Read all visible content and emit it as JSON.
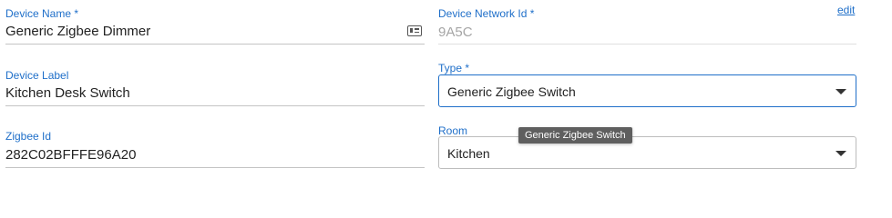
{
  "left": {
    "device_name": {
      "label": "Device Name *",
      "value": "Generic Zigbee Dimmer",
      "icon": "id-card-icon"
    },
    "device_label": {
      "label": "Device Label",
      "value": "Kitchen Desk Switch"
    },
    "zigbee_id": {
      "label": "Zigbee Id",
      "value": "282C02BFFFE96A20"
    }
  },
  "right": {
    "network_id": {
      "label": "Device Network Id *",
      "value": "9A5C",
      "edit_label": "edit"
    },
    "type": {
      "label": "Type *",
      "selected": "Generic Zigbee Switch"
    },
    "room": {
      "label": "Room",
      "selected": "Kitchen"
    }
  },
  "tooltip": {
    "text": "Generic Zigbee Switch"
  },
  "colors": {
    "accent": "#1f6fc9",
    "muted_text": "#a5a5a5",
    "tooltip_bg": "#5f5f5f"
  }
}
